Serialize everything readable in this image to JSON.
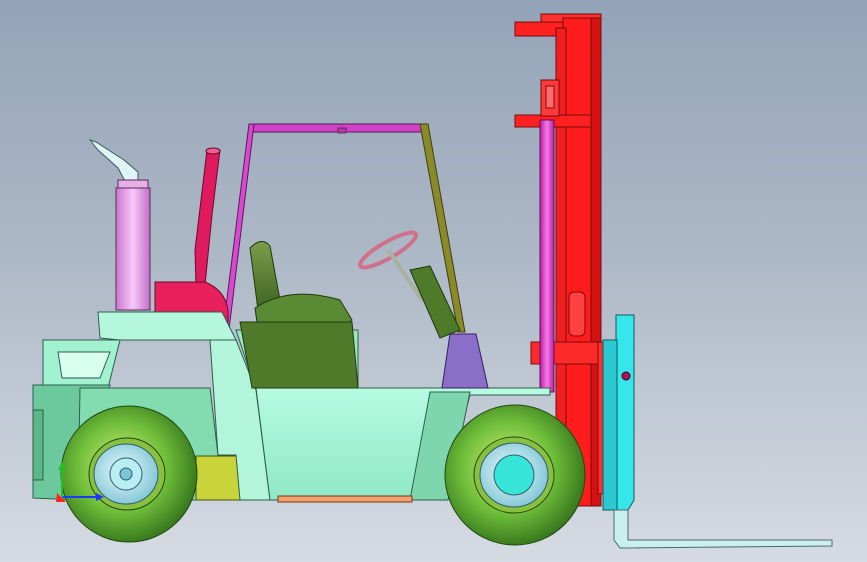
{
  "viewport": {
    "background_top": "#93a3b8",
    "background_bottom": "#d6dbe3"
  },
  "model": {
    "subject": "forklift",
    "view": "side",
    "colors": {
      "body": "#9ef5d4",
      "body_dark": "#6cc99e",
      "mast": "#ff1c1c",
      "mast_dark": "#c01010",
      "lift_cylinder": "#e84ad8",
      "carriage": "#37e6ea",
      "fork": "#c9f0ee",
      "exhaust": "#f0a8f0",
      "intake": "#e01a5e",
      "overhead_guard": "#d040c8",
      "seat": "#4f7a2a",
      "tire": "#6fbe3a",
      "tire_dark": "#2f6d1a",
      "hub": "#a8e0e8",
      "counterweight_plate": "#c8d43a",
      "control_panel": "#8a6fc8",
      "step": "#f4a070"
    }
  },
  "triad": {
    "x_axis_color": "#1a3bff",
    "y_axis_color": "#22c022",
    "z_axis_color": "#ff2020"
  }
}
